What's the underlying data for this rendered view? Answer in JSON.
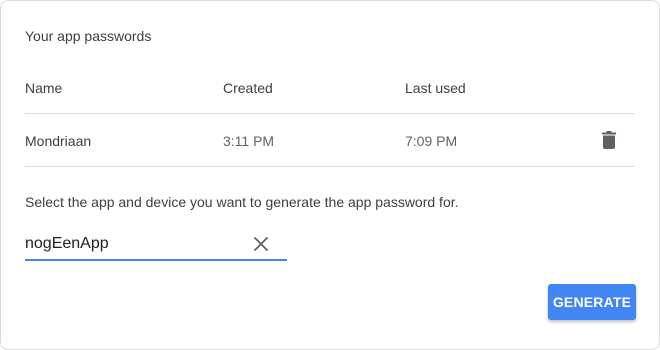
{
  "panel": {
    "title": "Your app passwords"
  },
  "table": {
    "headers": {
      "name": "Name",
      "created": "Created",
      "last_used": "Last used"
    },
    "rows": [
      {
        "name": "Mondriaan",
        "created": "3:11 PM",
        "last_used": "7:09 PM",
        "action_icon": "trash-icon"
      }
    ]
  },
  "generator": {
    "instruction": "Select the app and device you want to generate the app password for.",
    "input_value": "nogEenApp",
    "clear_icon": "close-icon",
    "generate_label": "GENERATE"
  },
  "colors": {
    "accent": "#4285f4",
    "divider": "#dadce0",
    "icon": "#5f6368"
  }
}
